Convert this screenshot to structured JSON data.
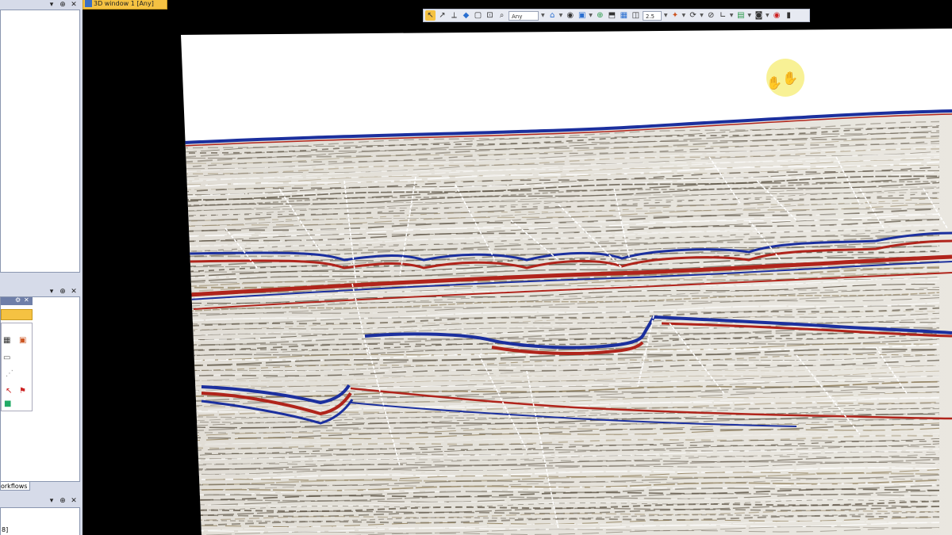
{
  "window": {
    "tab_label": "3D window 1 [Any]"
  },
  "left_panel": {
    "workflows_tab": "orkflows",
    "top_buttons": [
      "▾",
      "⊕",
      "✕"
    ],
    "mid_buttons": [
      "▾",
      "⊕",
      "✕"
    ],
    "bottom_buttons": [
      "▾",
      "⊕",
      "✕"
    ],
    "bottom_field": "8]"
  },
  "toolbar": {
    "filter_value": "Any",
    "zoom_value": "2.5"
  },
  "colors": {
    "accent_tab": "#f5c242",
    "cursor_highlight": "#f7f08a",
    "horizon_blue": "#1b2f9e",
    "horizon_red": "#b0241b"
  }
}
